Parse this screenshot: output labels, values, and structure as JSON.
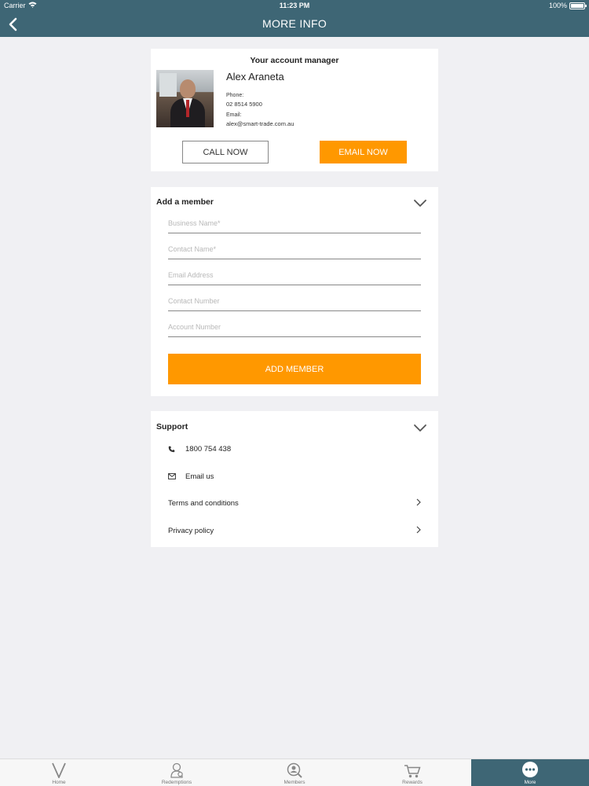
{
  "status_bar": {
    "carrier": "Carrier",
    "time": "11:23 PM",
    "battery": "100%"
  },
  "header": {
    "title": "MORE INFO"
  },
  "account_manager": {
    "heading": "Your account manager",
    "name": "Alex Araneta",
    "phone_label": "Phone:",
    "phone": "02 8514 5900",
    "email_label": "Email:",
    "email": "alex@smart-trade.com.au",
    "call_button": "CALL NOW",
    "email_button": "EMAIL NOW"
  },
  "add_member": {
    "title": "Add a member",
    "fields": {
      "business_name": {
        "placeholder": "Business Name*",
        "value": ""
      },
      "contact_name": {
        "placeholder": "Contact Name*",
        "value": ""
      },
      "email_address": {
        "placeholder": "Email Address",
        "value": ""
      },
      "contact_number": {
        "placeholder": "Contact Number",
        "value": ""
      },
      "account_number": {
        "placeholder": "Account Number",
        "value": ""
      }
    },
    "submit_button": "ADD MEMBER"
  },
  "support": {
    "title": "Support",
    "items": [
      {
        "label": "1800 754 438",
        "icon": "phone-icon"
      },
      {
        "label": "Email us",
        "icon": "envelope-icon"
      },
      {
        "label": "Terms and conditions",
        "icon": "chevron-right-icon"
      },
      {
        "label": "Privacy policy",
        "icon": "chevron-right-icon"
      }
    ]
  },
  "tab_bar": {
    "tabs": [
      {
        "label": "Home",
        "icon": "v-logo-icon"
      },
      {
        "label": "Redemptions",
        "icon": "user-icon"
      },
      {
        "label": "Members",
        "icon": "member-search-icon"
      },
      {
        "label": "Rewards",
        "icon": "cart-icon"
      },
      {
        "label": "More",
        "icon": "more-dots-icon"
      }
    ],
    "active_tab": "More"
  },
  "colors": {
    "header": "#3e6675",
    "accent": "#ff9800",
    "background": "#f0f0f3"
  }
}
